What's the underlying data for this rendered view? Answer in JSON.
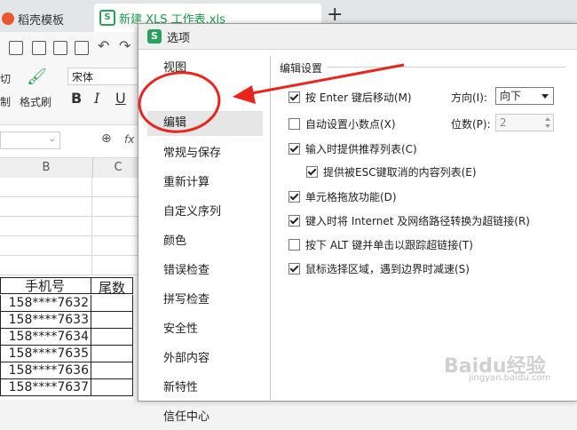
{
  "tabs": [
    {
      "label": "稻壳模板"
    },
    {
      "label": "新建 XLS 工作表.xls"
    }
  ],
  "toolbar": {
    "cut_label": "切",
    "copy_label": "制",
    "format_painter_label": "格式刷",
    "font_name": "宋体",
    "bold": "B",
    "italic": "I",
    "underline": "U"
  },
  "formula_bar": {
    "fx": "fx"
  },
  "columns": [
    "B",
    "C"
  ],
  "sheet": {
    "header_phone": "手机号",
    "header_tail": "尾数",
    "phones": [
      "158****7632",
      "158****7633",
      "158****7634",
      "158****7635",
      "158****7636",
      "158****7637"
    ]
  },
  "dialog": {
    "title": "选项",
    "nav": [
      {
        "label": "视图"
      },
      {
        "label": "编辑"
      },
      {
        "label": "常规与保存"
      },
      {
        "label": "重新计算"
      },
      {
        "label": "自定义序列"
      },
      {
        "label": "颜色"
      },
      {
        "label": "错误检查"
      },
      {
        "label": "拼写检查"
      },
      {
        "label": "安全性"
      },
      {
        "label": "外部内容"
      },
      {
        "label": "新特性"
      },
      {
        "label": "信任中心"
      }
    ],
    "selected_nav": "编辑",
    "section_title": "编辑设置",
    "options": [
      {
        "label": "按 Enter 键后移动(M)",
        "checked": true
      },
      {
        "label": "自动设置小数点(X)",
        "checked": false
      },
      {
        "label": "输入时提供推荐列表(C)",
        "checked": true
      },
      {
        "label": "提供被ESC键取消的内容列表(E)",
        "checked": true
      },
      {
        "label": "单元格拖放功能(D)",
        "checked": true
      },
      {
        "label": "键入时将 Internet 及网络路径转换为超链接(R)",
        "checked": true
      },
      {
        "label": "按下 ALT 键并单击以跟踪超链接(T)",
        "checked": false
      },
      {
        "label": "鼠标选择区域，遇到边界时减速(S)",
        "checked": true
      }
    ],
    "direction_label": "方向(I):",
    "direction_value": "向下",
    "digits_label": "位数(P):",
    "digits_value": "2"
  },
  "annotation": {
    "circle_color": "#e8261e",
    "arrow_color": "#e8261e"
  },
  "watermark": {
    "text": "Baidu经验",
    "url": "jingyan.baidu.com"
  }
}
